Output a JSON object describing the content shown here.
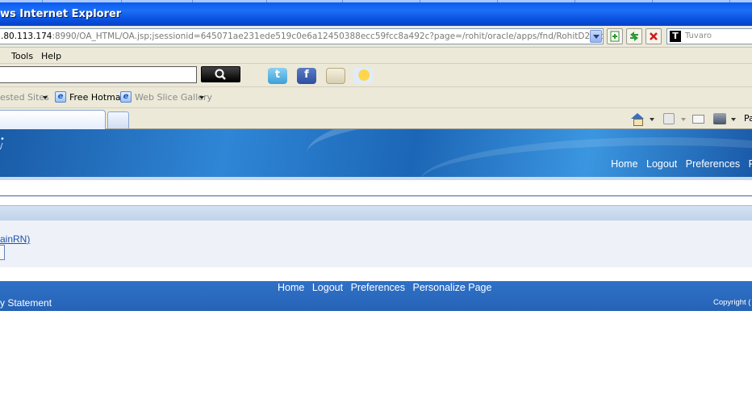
{
  "window": {
    "title": "ws Internet Explorer"
  },
  "address_bar": {
    "url_host": ".80.113.174",
    "url_rest": ":8990/OA_HTML/OA.jsp;jsessionid=645071ae231ede519c0e6a12450388ecc59fcc8a492c?page=/rohit/oracle/apps/fnd/RohitD2KFormCall/webui/RohitD2",
    "search_placeholder": "Tuvaro",
    "search_logo": "T"
  },
  "menu": {
    "items": [
      "Tools",
      "Help"
    ]
  },
  "favorites": {
    "suggested_sites": "ested Sites",
    "free_hotmail": "Free Hotmail",
    "web_slice_gallery": "Web Slice Gallery",
    "icon_letter": "e"
  },
  "command_bar": {
    "page_label": "Pa"
  },
  "app_header": {
    "global_links": [
      "Home",
      "Logout",
      "Preferences",
      "P"
    ]
  },
  "content": {
    "region_link": "ainRN)"
  },
  "footer": {
    "links": [
      "Home",
      "Logout",
      "Preferences",
      "Personalize Page"
    ],
    "privacy": "y Statement",
    "copyright": "Copyright ("
  },
  "colors": {
    "titlebar": "#0a52e0",
    "chrome": "#ece9d8",
    "oracle_header": "#2f86d6",
    "footer": "#2663b6",
    "link": "#1f4fa8"
  },
  "icons": {
    "search_button": "magnifier-icon",
    "toolbar": [
      "twitter-icon",
      "facebook-icon",
      "news-icon",
      "weather-icon"
    ],
    "command_bar": [
      "home-icon",
      "feeds-icon",
      "mail-icon",
      "print-icon"
    ]
  }
}
